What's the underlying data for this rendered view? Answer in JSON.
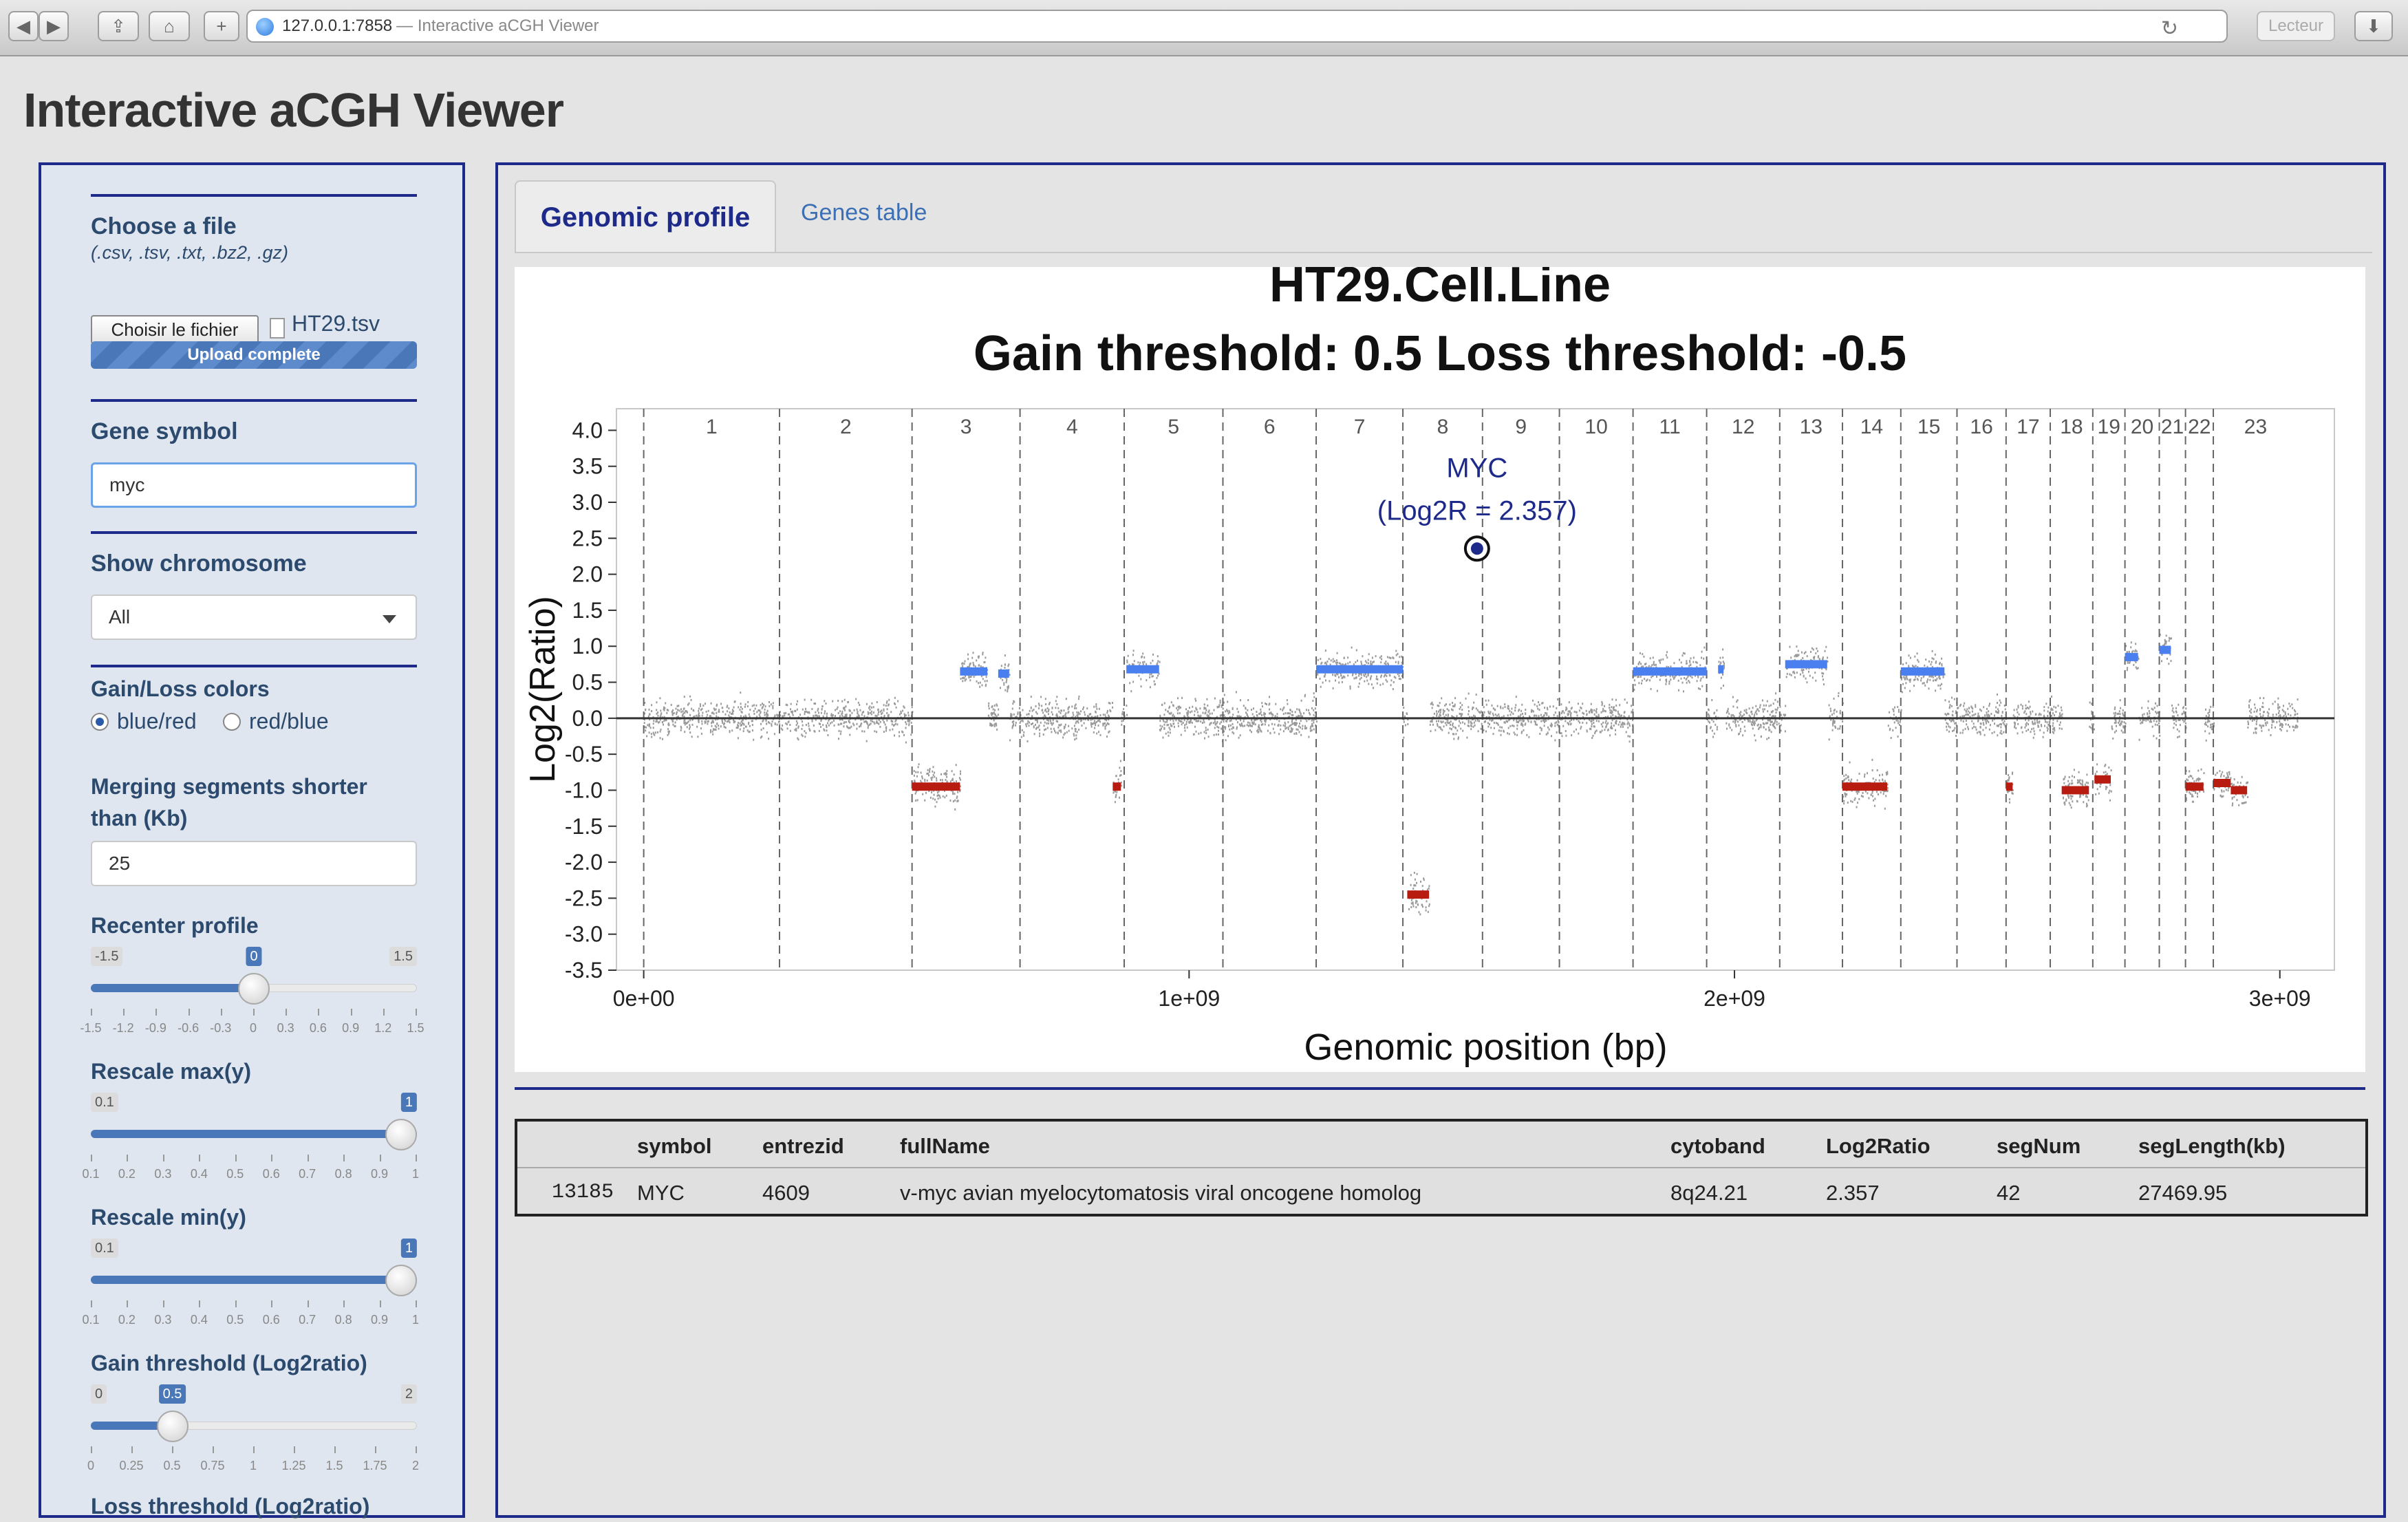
{
  "browser": {
    "url": "127.0.0.1:7858",
    "url_suffix": "— Interactive aCGH Viewer",
    "reader_label": "Lecteur"
  },
  "app": {
    "title": "Interactive aCGH Viewer"
  },
  "sidebar": {
    "file": {
      "label": "Choose a file",
      "hint": "(.csv, .tsv, .txt, .bz2, .gz)",
      "button_label": "Choisir le fichier",
      "filename": "HT29.tsv",
      "progress_label": "Upload complete"
    },
    "gene_symbol": {
      "label": "Gene symbol",
      "value": "myc"
    },
    "chromosome": {
      "label": "Show chromosome",
      "value": "All"
    },
    "colors": {
      "label": "Gain/Loss colors",
      "options": [
        "blue/red",
        "red/blue"
      ],
      "selected": "blue/red"
    },
    "merging": {
      "label": "Merging segments shorter than (Kb)",
      "value": "25"
    },
    "recenter": {
      "label": "Recenter profile",
      "min_label": "-1.5",
      "max_label": "1.5",
      "value_label": "0",
      "value_fraction": 0.5,
      "ticks": [
        "-1.5",
        "-1.2",
        "-0.9",
        "-0.6",
        "-0.3",
        "0",
        "0.3",
        "0.6",
        "0.9",
        "1.2",
        "1.5"
      ]
    },
    "rescale_max": {
      "label": "Rescale max(y)",
      "min_label": "0.1",
      "max_label": "1",
      "value_label": "1",
      "value_fraction": 1.0,
      "ticks": [
        "0.1",
        "0.2",
        "0.3",
        "0.4",
        "0.5",
        "0.6",
        "0.7",
        "0.8",
        "0.9",
        "1"
      ]
    },
    "rescale_min": {
      "label": "Rescale min(y)",
      "min_label": "0.1",
      "max_label": "1",
      "value_label": "1",
      "value_fraction": 1.0,
      "ticks": [
        "0.1",
        "0.2",
        "0.3",
        "0.4",
        "0.5",
        "0.6",
        "0.7",
        "0.8",
        "0.9",
        "1"
      ]
    },
    "gain_threshold": {
      "label": "Gain threshold (Log2ratio)",
      "min_label": "0",
      "max_label": "2",
      "value_label": "0.5",
      "value_fraction": 0.25,
      "ticks": [
        "0",
        "0.25",
        "0.5",
        "0.75",
        "1",
        "1.25",
        "1.5",
        "1.75",
        "2"
      ]
    },
    "loss_threshold": {
      "label": "Loss threshold (Log2ratio)"
    }
  },
  "tabs": {
    "profile": "Genomic profile",
    "genes": "Genes table"
  },
  "chart_data": {
    "type": "scatter",
    "title": "HT29.Cell.Line",
    "subtitle": "Gain threshold:  0.5  Loss threshold: -0.5",
    "xlabel": "Genomic position (bp)",
    "ylabel": "Log2(Ratio)",
    "xlim": [
      -50000000,
      3100000000
    ],
    "ylim": [
      -3.5,
      4.3
    ],
    "x_ticks": [
      0,
      1000000000,
      2000000000,
      3000000000
    ],
    "x_tick_labels": [
      "0e+00",
      "1e+09",
      "2e+09",
      "3e+09"
    ],
    "y_ticks": [
      4.0,
      3.5,
      3.0,
      2.5,
      2.0,
      1.5,
      1.0,
      0.5,
      0.0,
      -0.5,
      -1.0,
      -1.5,
      -2.0,
      -2.5,
      -3.0,
      -3.5
    ],
    "y_tick_labels": [
      "4.0",
      "3.5",
      "3.0",
      "2.5",
      "2.0",
      "1.5",
      "1.0",
      "0.5",
      "0.0",
      "-0.5",
      "-1.0",
      "-1.5",
      "-2.0",
      "-2.5",
      "-3.0",
      "-3.5"
    ],
    "chromosome_boundaries": [
      0,
      249,
      492,
      690,
      881,
      1062,
      1233,
      1392,
      1538,
      1679,
      1814,
      1949,
      2083,
      2198,
      2305,
      2408,
      2498,
      2579,
      2657,
      2716,
      2779,
      2827,
      2878,
      3033
    ],
    "boundary_unit": "Mb",
    "chromosomes": [
      "1",
      "2",
      "3",
      "4",
      "5",
      "6",
      "7",
      "8",
      "9",
      "10",
      "11",
      "12",
      "13",
      "14",
      "15",
      "16",
      "17",
      "18",
      "19",
      "20",
      "21",
      "22",
      "23"
    ],
    "grid": false,
    "segments": [
      {
        "start": 0,
        "end": 249,
        "value": 0.0,
        "status": "neutral"
      },
      {
        "start": 249,
        "end": 492,
        "value": 0.0,
        "status": "neutral"
      },
      {
        "start": 492,
        "end": 580,
        "value": -0.95,
        "status": "loss"
      },
      {
        "start": 580,
        "end": 630,
        "value": 0.65,
        "status": "gain"
      },
      {
        "start": 650,
        "end": 670,
        "value": 0.62,
        "status": "gain"
      },
      {
        "start": 860,
        "end": 875,
        "value": -0.95,
        "status": "loss"
      },
      {
        "start": 885,
        "end": 945,
        "value": 0.68,
        "status": "gain"
      },
      {
        "start": 1233,
        "end": 1392,
        "value": 0.68,
        "status": "gain"
      },
      {
        "start": 1400,
        "end": 1440,
        "value": -2.45,
        "status": "loss"
      },
      {
        "start": 1814,
        "end": 1949,
        "value": 0.65,
        "status": "gain"
      },
      {
        "start": 1970,
        "end": 1980,
        "value": 0.68,
        "status": "gain"
      },
      {
        "start": 2093,
        "end": 2170,
        "value": 0.75,
        "status": "gain"
      },
      {
        "start": 2198,
        "end": 2280,
        "value": -0.95,
        "status": "loss"
      },
      {
        "start": 2305,
        "end": 2385,
        "value": 0.65,
        "status": "gain"
      },
      {
        "start": 2498,
        "end": 2510,
        "value": -0.95,
        "status": "loss"
      },
      {
        "start": 2600,
        "end": 2650,
        "value": -1.0,
        "status": "loss"
      },
      {
        "start": 2660,
        "end": 2690,
        "value": -0.85,
        "status": "loss"
      },
      {
        "start": 2716,
        "end": 2740,
        "value": 0.85,
        "status": "gain"
      },
      {
        "start": 2779,
        "end": 2800,
        "value": 0.95,
        "status": "gain"
      },
      {
        "start": 2827,
        "end": 2860,
        "value": -0.95,
        "status": "loss"
      },
      {
        "start": 2878,
        "end": 2910,
        "value": -0.9,
        "status": "loss"
      },
      {
        "start": 2910,
        "end": 2940,
        "value": -1.0,
        "status": "loss"
      }
    ],
    "highlight": {
      "label": "MYC",
      "sublabel": "(Log2R = 2.357)",
      "x_mb": 1528,
      "y": 2.357
    },
    "colors": {
      "gain": "#4a7ff0",
      "loss": "#b81c10",
      "points": "#9a9a9a",
      "highlight": "#1e2a8a"
    }
  },
  "genes_table": {
    "columns": [
      "symbol",
      "entrezid",
      "fullName",
      "cytoband",
      "Log2Ratio",
      "segNum",
      "segLength(kb)"
    ],
    "rows": [
      {
        "index": "13185",
        "symbol": "MYC",
        "entrezid": "4609",
        "fullName": "v-myc avian myelocytomatosis viral oncogene homolog",
        "cytoband": "8q24.21",
        "Log2Ratio": "2.357",
        "segNum": "42",
        "segLength": "27469.95"
      }
    ]
  }
}
